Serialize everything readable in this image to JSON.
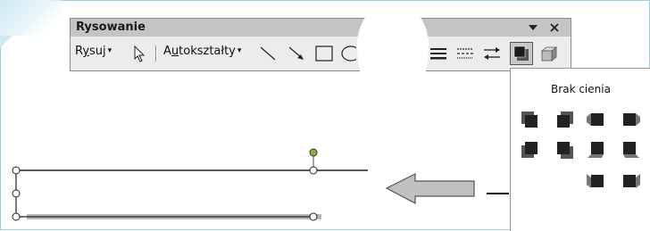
{
  "toolbar": {
    "title": "Rysowanie",
    "draw_menu": {
      "pre": "R",
      "under": "y",
      "post": "suj"
    },
    "autoshapes_menu": {
      "pre": "A",
      "under": "u",
      "post": "tokształty"
    },
    "dropdown_arrow": "▾",
    "icons": [
      "select-objects-icon",
      "line-icon",
      "arrow-icon",
      "rectangle-icon",
      "oval-icon",
      "line-style-icon",
      "dash-style-icon",
      "arrow-style-icon",
      "shadow-style-icon",
      "3d-style-icon"
    ]
  },
  "shadow_panel": {
    "no_shadow_label": "Brak cienia",
    "options_count": 18
  }
}
